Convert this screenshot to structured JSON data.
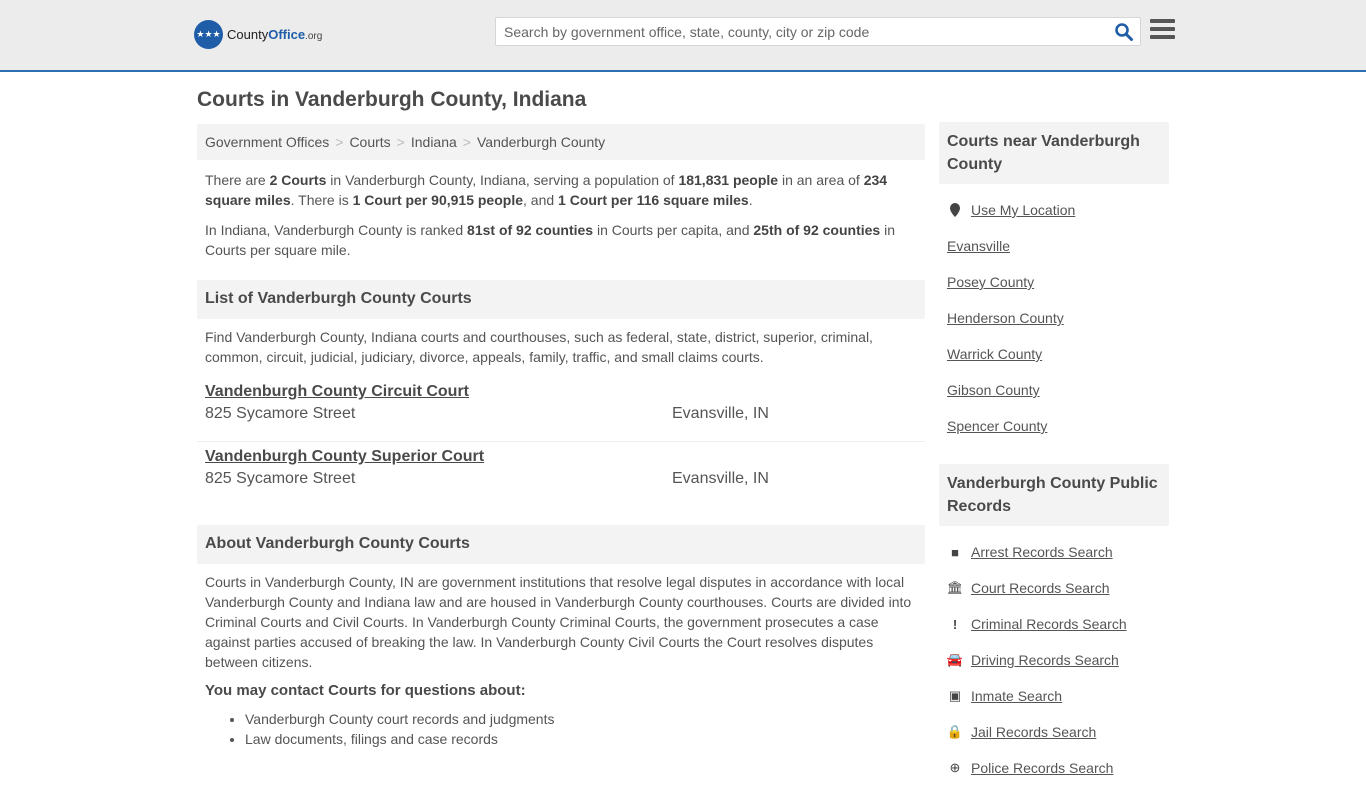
{
  "header": {
    "logo_main": "County",
    "logo_bold": "Office",
    "logo_suffix": ".org",
    "search_placeholder": "Search by government office, state, county, city or zip code"
  },
  "page_title": "Courts in Vanderburgh County, Indiana",
  "breadcrumb": [
    "Government Offices",
    "Courts",
    "Indiana",
    "Vanderburgh County"
  ],
  "summary": {
    "p1": [
      {
        "t": "There are ",
        "b": false
      },
      {
        "t": "2 Courts",
        "b": true
      },
      {
        "t": " in Vanderburgh County, Indiana, serving a population of ",
        "b": false
      },
      {
        "t": "181,831 people",
        "b": true
      },
      {
        "t": " in an area of ",
        "b": false
      },
      {
        "t": "234 square miles",
        "b": true
      },
      {
        "t": ". There is ",
        "b": false
      },
      {
        "t": "1 Court per 90,915 people",
        "b": true
      },
      {
        "t": ", and ",
        "b": false
      },
      {
        "t": "1 Court per 116 square miles",
        "b": true
      },
      {
        "t": ".",
        "b": false
      }
    ],
    "p2": [
      {
        "t": "In Indiana, Vanderburgh County is ranked ",
        "b": false
      },
      {
        "t": "81st of 92 counties",
        "b": true
      },
      {
        "t": " in Courts per capita, and ",
        "b": false
      },
      {
        "t": "25th of 92 counties",
        "b": true
      },
      {
        "t": " in Courts per square mile.",
        "b": false
      }
    ]
  },
  "list_section": {
    "heading": "List of Vanderburgh County Courts",
    "description": "Find Vanderburgh County, Indiana courts and courthouses, such as federal, state, district, superior, criminal, common, circuit, judicial, judiciary, divorce, appeals, family, traffic, and small claims courts.",
    "courts": [
      {
        "name": "Vandenburgh County Circuit Court",
        "address": "825 Sycamore Street",
        "city": "Evansville, IN"
      },
      {
        "name": "Vandenburgh County Superior Court",
        "address": "825 Sycamore Street",
        "city": "Evansville, IN"
      }
    ]
  },
  "about_section": {
    "heading": "About Vanderburgh County Courts",
    "text": "Courts in Vanderburgh County, IN are government institutions that resolve legal disputes in accordance with local Vanderburgh County and Indiana law and are housed in Vanderburgh County courthouses. Courts are divided into Criminal Courts and Civil Courts. In Vanderburgh County Criminal Courts, the government prosecutes a case against parties accused of breaking the law. In Vanderburgh County Civil Courts the Court resolves disputes between citizens.",
    "contact_heading": "You may contact Courts for questions about:",
    "contact_items": [
      "Vanderburgh County court records and judgments",
      "Law documents, filings and case records"
    ]
  },
  "sidebar": {
    "nearby_heading": "Courts near Vanderburgh County",
    "use_location": "Use My Location",
    "nearby": [
      "Evansville",
      "Posey County",
      "Henderson County",
      "Warrick County",
      "Gibson County",
      "Spencer County"
    ],
    "records_heading": "Vanderburgh County Public Records",
    "records": [
      {
        "label": "Arrest Records Search",
        "icon": "square-icon"
      },
      {
        "label": "Court Records Search",
        "icon": "courthouse-icon"
      },
      {
        "label": "Criminal Records Search",
        "icon": "exclamation-icon"
      },
      {
        "label": "Driving Records Search",
        "icon": "car-icon"
      },
      {
        "label": "Inmate Search",
        "icon": "id-badge-icon"
      },
      {
        "label": "Jail Records Search",
        "icon": "lock-icon"
      },
      {
        "label": "Police Records Search",
        "icon": "police-badge-icon"
      }
    ]
  }
}
